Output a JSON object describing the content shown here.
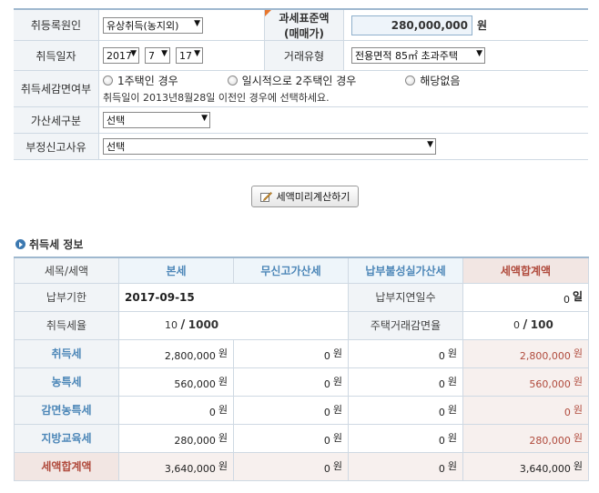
{
  "form": {
    "acquisition_cause": {
      "label": "취등록원인",
      "value": "유상취득(농지외)"
    },
    "tax_base": {
      "label_line1": "과세표준액",
      "label_line2": "(매매가)",
      "value": "280,000,000",
      "unit": "원"
    },
    "acquisition_date": {
      "label": "취득일자",
      "year": "2017",
      "month": "7",
      "day": "17"
    },
    "trade_type": {
      "label": "거래유형",
      "value": "전용면적 85㎡ 초과주택"
    },
    "reduction": {
      "label": "취득세감면여부",
      "options": [
        "1주택인 경우",
        "일시적으로 2주택인 경우",
        "해당없음"
      ],
      "note": "취득일이 2013년8월28일 이전인 경우에 선택하세요."
    },
    "penalty_type": {
      "label": "가산세구분",
      "value": "선택"
    },
    "improper_report": {
      "label": "부정신고사유",
      "value": "선택"
    }
  },
  "calc_button": "세액미리계산하기",
  "section_title": "취득세 정보",
  "table": {
    "headers": [
      "세목/세액",
      "본세",
      "무신고가산세",
      "납부불성실가산세",
      "세액합계액"
    ],
    "due_label": "납부기한",
    "due_value": "2017-09-15",
    "delay_label": "납부지연일수",
    "delay_value": "0",
    "delay_unit": "일",
    "rate_label": "취득세율",
    "rate_num": "10",
    "rate_den": "1000",
    "reduce_label": "주택거래감면율",
    "reduce_num": "0",
    "reduce_den": "100",
    "unit": "원",
    "rows": [
      {
        "label": "취득세",
        "base": "2,800,000",
        "no_report": "0",
        "late": "0",
        "total": "2,800,000"
      },
      {
        "label": "농특세",
        "base": "560,000",
        "no_report": "0",
        "late": "0",
        "total": "560,000"
      },
      {
        "label": "감면농특세",
        "base": "0",
        "no_report": "0",
        "late": "0",
        "total": "0"
      },
      {
        "label": "지방교육세",
        "base": "280,000",
        "no_report": "0",
        "late": "0",
        "total": "280,000"
      },
      {
        "label": "세액합계액",
        "base": "3,640,000",
        "no_report": "0",
        "late": "0",
        "total": "3,640,000"
      }
    ]
  },
  "colors": {
    "accent": "#4d87b8",
    "total": "#b04a3c",
    "header_border": "#9fb8cf"
  }
}
